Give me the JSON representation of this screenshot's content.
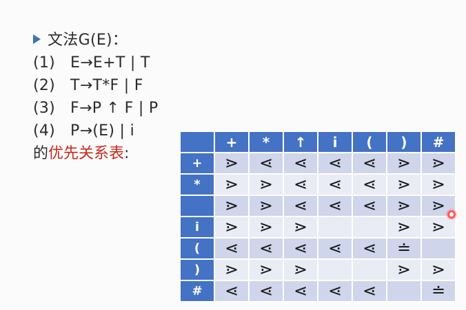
{
  "grammar": {
    "title": "文法G(E)：",
    "rules": [
      {
        "num": "(1)",
        "text": "E→E+T | T"
      },
      {
        "num": "(2)",
        "text": "T→T*F | F"
      },
      {
        "num": "(3)",
        "text": "F→P ↑ F | P"
      },
      {
        "num": "(4)",
        "text": "P→(E) | i"
      }
    ],
    "caption_prefix": "的",
    "caption_highlight": "优先关系表",
    "caption_suffix": ":"
  },
  "table": {
    "columns": [
      "+",
      "*",
      "↑",
      "i",
      "(",
      ")",
      "#"
    ],
    "rows": [
      {
        "label": "+",
        "cells": [
          "⋗",
          "⋖",
          "⋖",
          "⋖",
          "⋖",
          "⋗",
          "⋗"
        ]
      },
      {
        "label": "*",
        "cells": [
          "⋗",
          "⋗",
          "⋖",
          "⋖",
          "⋖",
          "⋗",
          "⋗"
        ]
      },
      {
        "label": "",
        "cells": [
          "⋗",
          "⋗",
          "⋖",
          "⋖",
          "⋖",
          "⋗",
          "⋗"
        ]
      },
      {
        "label": "i",
        "cells": [
          "⋗",
          "⋗",
          "⋗",
          "",
          "",
          "⋗",
          "⋗"
        ]
      },
      {
        "label": "(",
        "cells": [
          "⋖",
          "⋖",
          "⋖",
          "⋖",
          "⋖",
          "≐",
          ""
        ]
      },
      {
        "label": ")",
        "cells": [
          "⋗",
          "⋗",
          "⋗",
          "",
          "",
          "⋗",
          "⋗"
        ]
      },
      {
        "label": "#",
        "cells": [
          "⋖",
          "⋖",
          "⋖",
          "⋖",
          "⋖",
          "",
          "≐"
        ]
      }
    ]
  },
  "colors": {
    "header_blue": "#4472c4",
    "band_dark": "#cfd5ea",
    "band_light": "#e9ebf5",
    "highlight_red": "#c42a1f",
    "pointer_dot": "#ff5a5a"
  }
}
